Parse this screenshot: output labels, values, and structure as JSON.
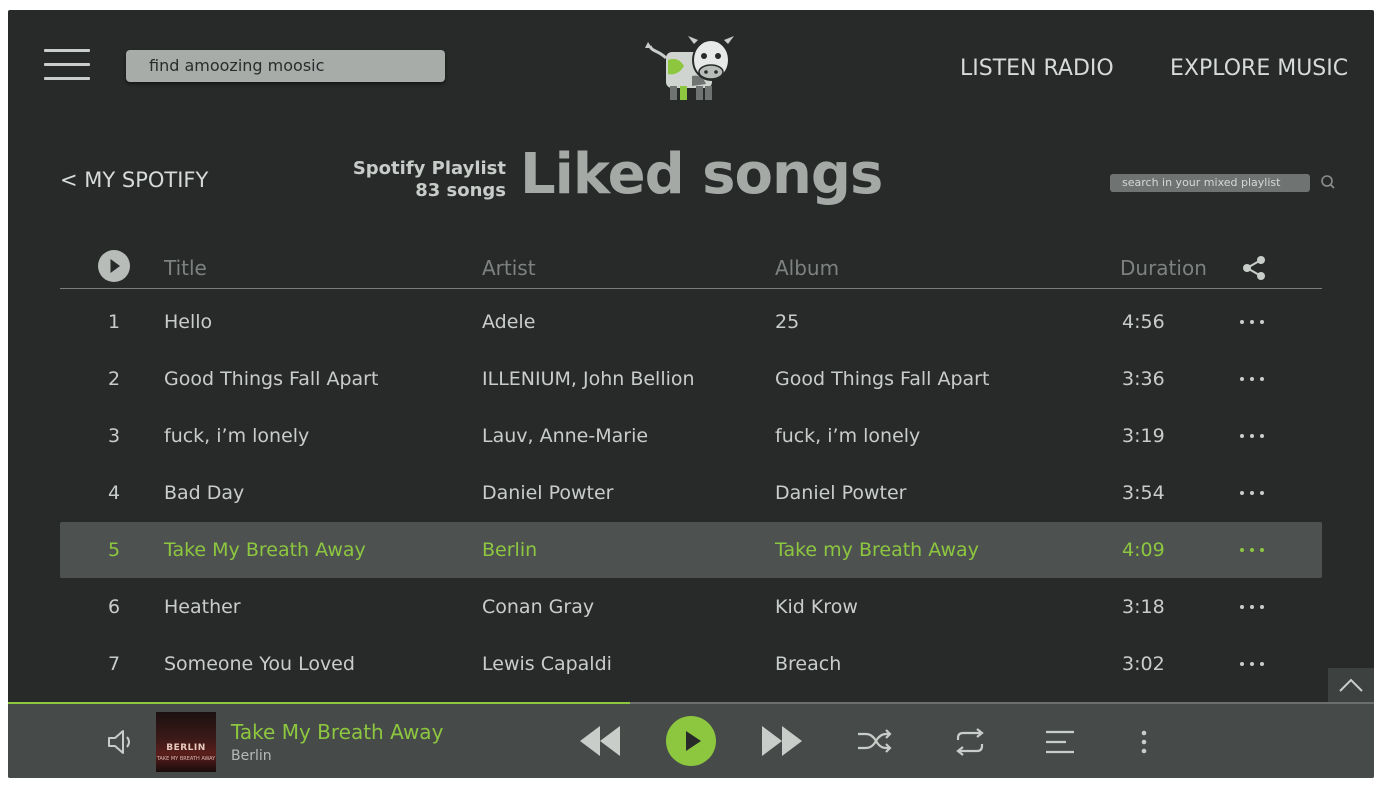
{
  "header": {
    "search_value": "find amoozing moosic",
    "nav": [
      "LISTEN RADIO",
      "EXPLORE MUSIC"
    ]
  },
  "playlist": {
    "back_label": "< MY SPOTIFY",
    "kind": "Spotify Playlist",
    "count": "83 songs",
    "title": "Liked songs",
    "search_placeholder": "search in your mixed playlist"
  },
  "table": {
    "columns": {
      "title": "Title",
      "artist": "Artist",
      "album": "Album",
      "duration": "Duration"
    },
    "rows": [
      {
        "num": "1",
        "title": "Hello",
        "artist": "Adele",
        "album": "25",
        "duration": "4:56"
      },
      {
        "num": "2",
        "title": "Good Things Fall Apart",
        "artist": "ILLENIUM, John Bellion",
        "album": "Good Things Fall Apart",
        "duration": "3:36"
      },
      {
        "num": "3",
        "title": "fuck, i’m lonely",
        "artist": "Lauv, Anne-Marie",
        "album": "fuck, i’m lonely",
        "duration": "3:19"
      },
      {
        "num": "4",
        "title": "Bad Day",
        "artist": "Daniel Powter",
        "album": "Daniel Powter",
        "duration": "3:54"
      },
      {
        "num": "5",
        "title": "Take My Breath Away",
        "artist": "Berlin",
        "album": "Take my Breath Away",
        "duration": "4:09",
        "active": true
      },
      {
        "num": "6",
        "title": "Heather",
        "artist": "Conan Gray",
        "album": "Kid Krow",
        "duration": "3:18"
      },
      {
        "num": "7",
        "title": "Someone You Loved",
        "artist": "Lewis Capaldi",
        "album": "Breach",
        "duration": "3:02"
      }
    ]
  },
  "player": {
    "title": "Take My Breath Away",
    "artist": "Berlin",
    "cover_text": "BERLIN",
    "cover_subtext": "TAKE MY BREATH AWAY",
    "progress": 0.455
  },
  "colors": {
    "background": "#282a2a",
    "accent": "#8dc63f",
    "text": "#c9cdca",
    "active_row": "#4d5251"
  },
  "icons": [
    "menu-icon",
    "cow-logo-icon",
    "search-icon",
    "play-icon",
    "share-icon",
    "more-icon",
    "chevron-up-icon",
    "volume-icon",
    "rewind-icon",
    "fast-forward-icon",
    "shuffle-icon",
    "repeat-icon",
    "queue-icon",
    "kebab-icon"
  ]
}
